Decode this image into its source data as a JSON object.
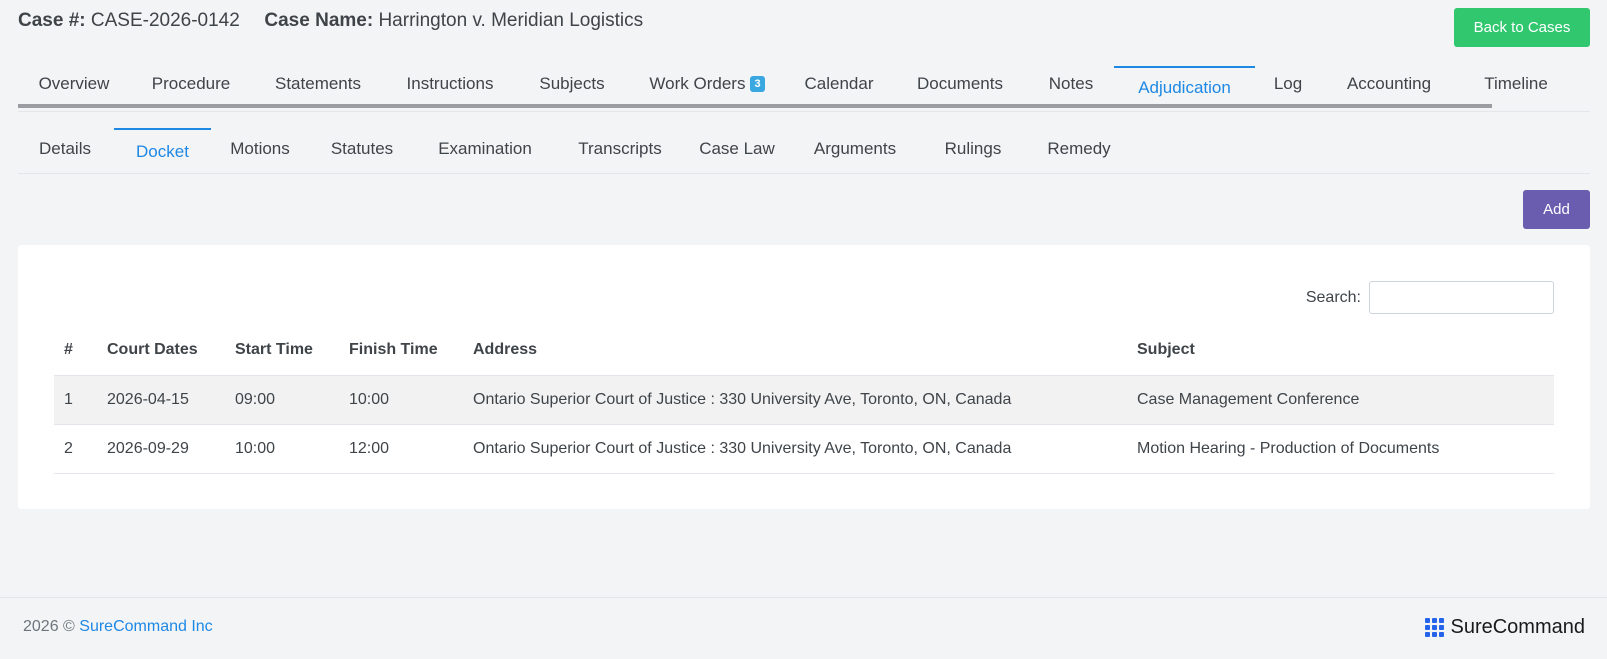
{
  "header": {
    "case_number_label": "Case #:",
    "case_number": "CASE-2026-0142",
    "case_name_label": "Case Name:",
    "case_name": "Harrington v. Meridian Logistics",
    "back_button": "Back to Cases"
  },
  "main_tabs": [
    {
      "label": "Overview"
    },
    {
      "label": "Procedure"
    },
    {
      "label": "Statements"
    },
    {
      "label": "Instructions"
    },
    {
      "label": "Subjects"
    },
    {
      "label": "Work Orders",
      "badge": "3"
    },
    {
      "label": "Calendar"
    },
    {
      "label": "Documents"
    },
    {
      "label": "Notes"
    },
    {
      "label": "Adjudication",
      "active": true
    },
    {
      "label": "Log"
    },
    {
      "label": "Accounting"
    },
    {
      "label": "Timeline"
    }
  ],
  "sub_tabs": [
    {
      "label": "Details"
    },
    {
      "label": "Docket",
      "active": true
    },
    {
      "label": "Motions"
    },
    {
      "label": "Statutes"
    },
    {
      "label": "Examination"
    },
    {
      "label": "Transcripts"
    },
    {
      "label": "Case Law"
    },
    {
      "label": "Arguments"
    },
    {
      "label": "Rulings"
    },
    {
      "label": "Remedy"
    }
  ],
  "toolbar": {
    "add_label": "Add"
  },
  "search": {
    "label": "Search:",
    "value": ""
  },
  "table": {
    "headers": [
      "#",
      "Court Dates",
      "Start Time",
      "Finish Time",
      "Address",
      "Subject"
    ],
    "rows": [
      [
        "1",
        "2026-04-15",
        "09:00",
        "10:00",
        "Ontario Superior Court of Justice : 330 University Ave, Toronto, ON, Canada",
        "Case Management Conference"
      ],
      [
        "2",
        "2026-09-29",
        "10:00",
        "12:00",
        "Ontario Superior Court of Justice : 330 University Ave, Toronto, ON, Canada",
        "Motion Hearing - Production of Documents"
      ]
    ]
  },
  "footer": {
    "year": "2026 ©",
    "company": "SureCommand Inc",
    "brand": "SureCommand",
    "brand_icon": "grid-dots-icon",
    "brand_color": "#2563eb"
  },
  "colors": {
    "accent": "#1e88e5",
    "back_button": "#31c76f",
    "add_button": "#6a5db0",
    "badge": "#39a8e0"
  }
}
